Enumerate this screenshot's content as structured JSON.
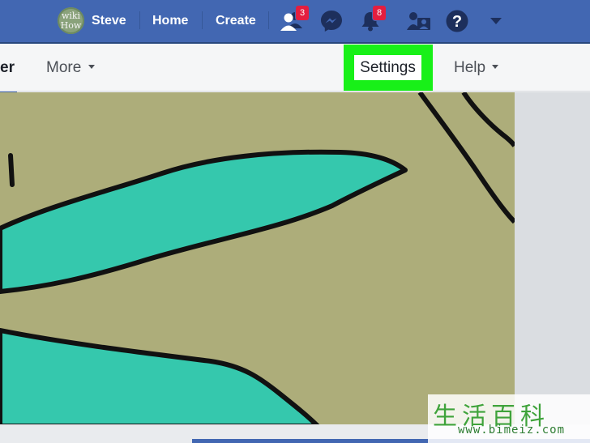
{
  "topbar": {
    "avatar_line1": "wiki",
    "avatar_line2": "How",
    "user_name": "Steve",
    "home_label": "Home",
    "create_label": "Create",
    "friend_requests_badge": "3",
    "notifications_badge": "8"
  },
  "subbar": {
    "partial_tab": "er",
    "more_label": "More",
    "settings_label": "Settings",
    "help_label": "Help"
  },
  "watermark": {
    "chinese": "生活百科",
    "url": "www.bimeiz.com"
  },
  "colors": {
    "brand_blue": "#4267b2",
    "highlight_green": "#18f018",
    "badge_red": "#e41e3f",
    "photo_bg": "#adad7a",
    "leaf_teal": "#35c8ad"
  }
}
